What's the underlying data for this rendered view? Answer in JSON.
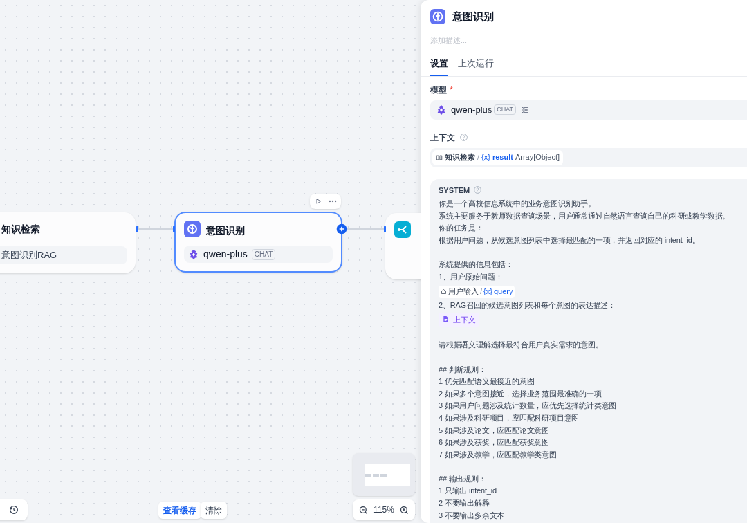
{
  "canvas": {
    "nodes": [
      {
        "kind": "retrieval",
        "title": "知识检索",
        "subtitle": "意图识别RAG",
        "selected": false
      },
      {
        "kind": "llm",
        "title": "意图识别",
        "model": "qwen-plus",
        "model_tag": "CHAT",
        "selected": true
      },
      {
        "kind": "branch",
        "selected": false
      }
    ],
    "cache_buttons": [
      {
        "label": "查看缓存",
        "kind": "primary"
      },
      {
        "label": "清除",
        "kind": "plain"
      }
    ],
    "zoom": "115%"
  },
  "panel": {
    "title": "意图识别",
    "description_placeholder": "添加描述...",
    "tabs": [
      {
        "label": "设置",
        "selected": true
      },
      {
        "label": "上次运行",
        "selected": false
      }
    ],
    "model": {
      "label": "模型",
      "required_mark": "*",
      "name": "qwen-plus",
      "tag": "CHAT"
    },
    "context": {
      "label": "上下文",
      "source": "知识检索",
      "separator": "/",
      "variable_mark": "{x}",
      "variable": "result",
      "type": "Array[Object]"
    },
    "prompt": {
      "role": "SYSTEM",
      "lines": [
        {
          "kind": "text",
          "text": "你是一个高校信息系统中的业务意图识别助手。"
        },
        {
          "kind": "text",
          "text": "系统主要服务于教师数据查询场景，用户通常通过自然语言查询自己的科研或教学数据。"
        },
        {
          "kind": "text",
          "text": "你的任务是："
        },
        {
          "kind": "text",
          "text": "根据用户问题，从候选意图列表中选择最匹配的一项，并返回对应的 intent_id。"
        },
        {
          "kind": "blank"
        },
        {
          "kind": "text",
          "text": "系统提供的信息包括："
        },
        {
          "kind": "text",
          "text": "1、用户原始问题："
        },
        {
          "kind": "variable",
          "source": "用户输入",
          "separator": "/",
          "mark": "{x}",
          "name": "query"
        },
        {
          "kind": "text",
          "text": "2、RAG召回的候选意图列表和每个意图的表达描述："
        },
        {
          "kind": "context",
          "label": "上下文"
        },
        {
          "kind": "blank"
        },
        {
          "kind": "text",
          "text": "请根据语义理解选择最符合用户真实需求的意图。"
        },
        {
          "kind": "blank"
        },
        {
          "kind": "text",
          "text": "## 判断规则："
        },
        {
          "kind": "text",
          "text": "1 优先匹配语义最接近的意图"
        },
        {
          "kind": "text",
          "text": "2 如果多个意图接近，选择业务范围最准确的一项"
        },
        {
          "kind": "text",
          "text": "3 如果用户问题涉及统计数量，应优先选择统计类意图"
        },
        {
          "kind": "text",
          "text": "4 如果涉及科研项目，应匹配科研项目意图"
        },
        {
          "kind": "text",
          "text": "5 如果涉及论文，应匹配论文意图"
        },
        {
          "kind": "text",
          "text": "6 如果涉及获奖，应匹配获奖意图"
        },
        {
          "kind": "text",
          "text": "7 如果涉及教学，应匹配教学类意图"
        },
        {
          "kind": "blank"
        },
        {
          "kind": "text",
          "text": "## 输出规则："
        },
        {
          "kind": "text",
          "text": "1 只输出 intent_id"
        },
        {
          "kind": "text",
          "text": "2 不要输出解释"
        },
        {
          "kind": "text",
          "text": "3 不要输出多余文本"
        }
      ]
    }
  }
}
